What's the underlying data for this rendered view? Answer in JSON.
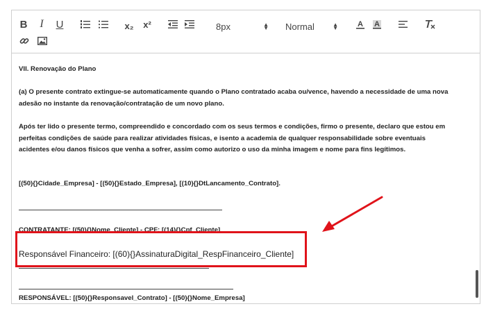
{
  "toolbar": {
    "bold": "B",
    "italic": "I",
    "underline": "U",
    "subscript": "x₂",
    "superscript": "x²",
    "font_size": "8px",
    "heading": "Normal"
  },
  "content": {
    "section_title": "VII. Renovação do Plano",
    "para1_line1": "(a) O presente contrato extingue-se automaticamente quando o Plano contratado acaba ou/vence, havendo a necessidade de uma nova",
    "para1_line2": "adesão no instante da renovação/contratação de um novo plano.",
    "para2_line1": "Após ter lido o presente termo, compreendido e concordado com os seus termos e condições, firmo o presente, declaro que estou em",
    "para2_line2": "perfeitas condições de saúde para realizar atividades físicas, e isento a academia de qualquer responsabilidade sobre eventuais",
    "para2_line3": "acidentes e/ou danos físicos que venha a sofrer, assim como autorizo o uso da minha imagem e nome para fins legítimos.",
    "city_line": "[(50){}Cidade_Empresa] - [(50){}Estado_Empresa], [(10){}DtLancamento_Contrato].",
    "contratante": "CONTRATANTE: [(50){}Nome_Cliente] - CPF: [(14){}Cpf_Cliente]",
    "responsavel_financeiro": "Responsável Financeiro: [(60){}AssinaturaDigital_RespFinanceiro_Cliente]",
    "responsavel": "RESPONSÁVEL: [(50){}Responsavel_Contrato] - [(50){}Nome_Empresa]"
  },
  "colors": {
    "highlight": "#e0131a",
    "text": "#222222",
    "border": "#cfcfcf"
  }
}
